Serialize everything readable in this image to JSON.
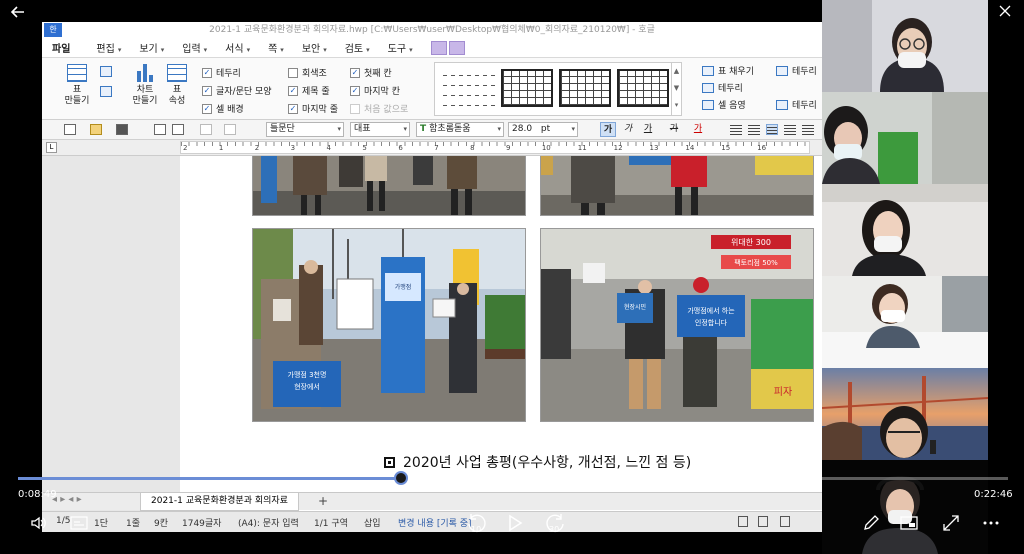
{
  "player": {
    "current_time": "0:08:49",
    "total_time": "0:22:46",
    "progress": 0.387,
    "skip_back_seconds": "10",
    "skip_forward_seconds": "30"
  },
  "window": {
    "title": "2021-1 교육문화환경분과 회의자료.hwp [C:₩Users₩user₩Desktop₩협의체₩0_회의자료_210120₩] - 호글"
  },
  "menu": {
    "items": [
      "파일",
      "편집",
      "보기",
      "입력",
      "서식",
      "쪽",
      "보안",
      "검토",
      "도구"
    ]
  },
  "ribbon": {
    "table_button": "표\n만들기",
    "chart_button": "차트\n만들기",
    "props_button": "표\n속성",
    "checkboxes": [
      {
        "label": "테두리",
        "checked": true
      },
      {
        "label": "회색조",
        "checked": false
      },
      {
        "label": "첫째 칸",
        "checked": true
      },
      {
        "label": "글자/문단 모양",
        "checked": true
      },
      {
        "label": "제목 줄",
        "checked": true
      },
      {
        "label": "마지막 칸",
        "checked": true
      },
      {
        "label": "셀 배경",
        "checked": true
      },
      {
        "label": "마지막 줄",
        "checked": true
      },
      {
        "label": "처음 값으로",
        "checked": false
      }
    ],
    "right_items": [
      "표 채우기",
      "테두리",
      "테두리",
      "셀 음영",
      "테두리"
    ]
  },
  "format_bar": {
    "style": "틀문단",
    "lang": "대표",
    "font": "함초롬돋움",
    "size": "28.0",
    "size_unit": "pt",
    "bold": "가",
    "italic": "가",
    "underline": "가",
    "strike": "가"
  },
  "ruler": {
    "marks": [
      "2",
      "1",
      "2",
      "3",
      "4",
      "5",
      "6",
      "7",
      "8",
      "9",
      "10",
      "11",
      "12",
      "13",
      "14",
      "15",
      "16"
    ]
  },
  "document": {
    "caption": "2020년 사업 총평(우수사항, 개선점, 느낀 점 등)",
    "photo_text": [
      "가맹점 3천명 현장에서 인정합니다",
      "가맹점에서 하는 현장시민의 인정합니다",
      "위대한 300",
      "팩토리점 50%",
      "피자"
    ]
  },
  "tabs": {
    "doc_tab": "2021-1 교육문화환경분과 회의자료"
  },
  "status": {
    "page": "1/5",
    "section": "1단",
    "line": "1줄",
    "col": "9칸",
    "chars": "1749글자",
    "mode": "(A4): 문자 입력",
    "area": "1/1 구역",
    "insert": "삽입",
    "track": "변경 내용 [기록 중]"
  },
  "colors": {
    "accent": "#6b8dd6",
    "app_blue": "#2f6fd1"
  }
}
